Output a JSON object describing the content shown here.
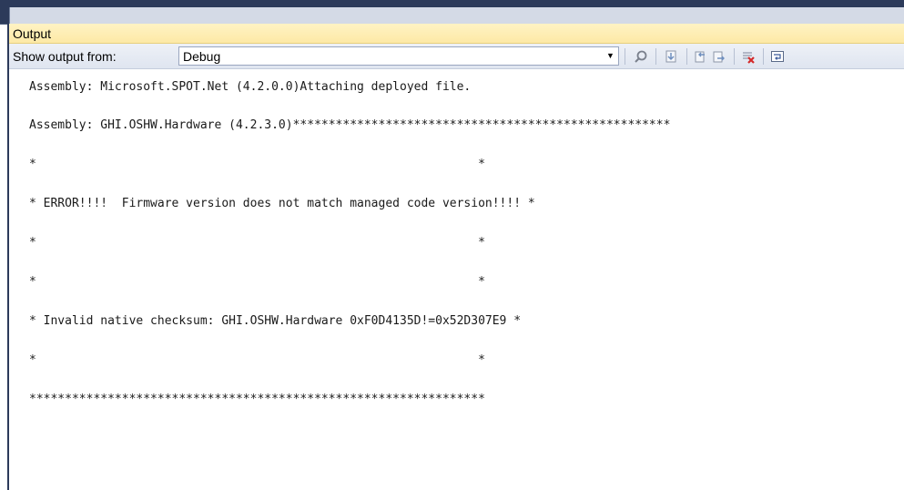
{
  "window": {
    "title": "Output"
  },
  "toolbar": {
    "show_output_label": "Show output from:",
    "source_selected": "Debug",
    "buttons": [
      {
        "name": "find-message-in-code-icon"
      },
      {
        "name": "go-to-previous-message-icon"
      },
      {
        "name": "go-to-next-message-icon"
      },
      {
        "name": "clear-all-icon"
      },
      {
        "name": "toggle-word-wrap-icon"
      }
    ]
  },
  "output": {
    "lines": [
      "Assembly: Microsoft.SPOT.Net (4.2.0.0)Attaching deployed file.",
      "Assembly: GHI.OSHW.Hardware (4.2.3.0)*****************************************************",
      "*                                                              *",
      "* ERROR!!!!  Firmware version does not match managed code version!!!! *",
      "*                                                              *",
      "*                                                              *",
      "* Invalid native checksum: GHI.OSHW.Hardware 0xF0D4135D!=0x52D307E9 *",
      "*                                                              *",
      "****************************************************************"
    ]
  },
  "colors": {
    "title_bar": "#fde9a6",
    "toolbar": "#dfe5f0",
    "frame": "#2c3a5a",
    "clear_icon_red": "#d42a2a"
  }
}
